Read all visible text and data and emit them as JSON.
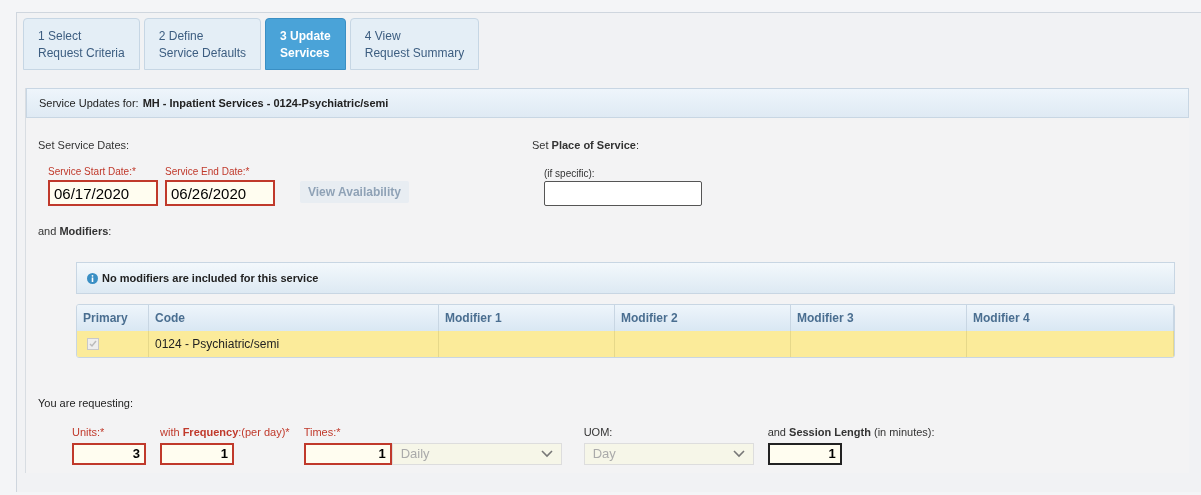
{
  "tabs": [
    {
      "number": "1 Select",
      "label": "Request Criteria",
      "selected": false
    },
    {
      "number": "2 Define",
      "label": "Service Defaults",
      "selected": false
    },
    {
      "number": "3 Update",
      "label": "Services",
      "selected": true
    },
    {
      "number": "4 View",
      "label": "Request Summary",
      "selected": false
    }
  ],
  "header": {
    "label": "Service Updates for:",
    "value": "MH - Inpatient Services - 0124-Psychiatric/semi"
  },
  "dates": {
    "title": "Set Service Dates:",
    "start": {
      "label": "Service Start Date:*",
      "value": "06/17/2020",
      "required": true
    },
    "end": {
      "label": "Service End Date:*",
      "value": "06/26/2020",
      "required": true
    },
    "button": {
      "label": "View Availability",
      "disabled": true
    }
  },
  "place": {
    "title": "Set **Place of Service**:",
    "label": "(if specific):"
  },
  "modifiers": {
    "title": "and **Modifiers**:",
    "info": "No modifiers are included for this service",
    "columns": [
      "Primary",
      "Code",
      "Modifier 1",
      "Modifier 2",
      "Modifier 3",
      "Modifier 4"
    ],
    "rows": [
      {
        "primary": true,
        "code": "0124 - Psychiatric/semi",
        "selected": true
      }
    ]
  },
  "requesting": {
    "title": "You are requesting:",
    "fields": [
      {
        "kind": "input",
        "label": "Units:*",
        "value": "3",
        "required": true
      },
      {
        "kind": "input",
        "label": "with **Frequency**:(per day)*",
        "value": "1",
        "required": true
      },
      {
        "kind": "input-select",
        "label": "Times:*",
        "value": "1",
        "required": true,
        "option": "Daily",
        "disabled": true
      },
      {
        "kind": "select",
        "label": "UOM:",
        "option": "Day",
        "required": false,
        "disabled": true
      },
      {
        "kind": "input",
        "label": "and **Session Length** (in minutes):",
        "value": "1",
        "required": false
      }
    ]
  }
}
